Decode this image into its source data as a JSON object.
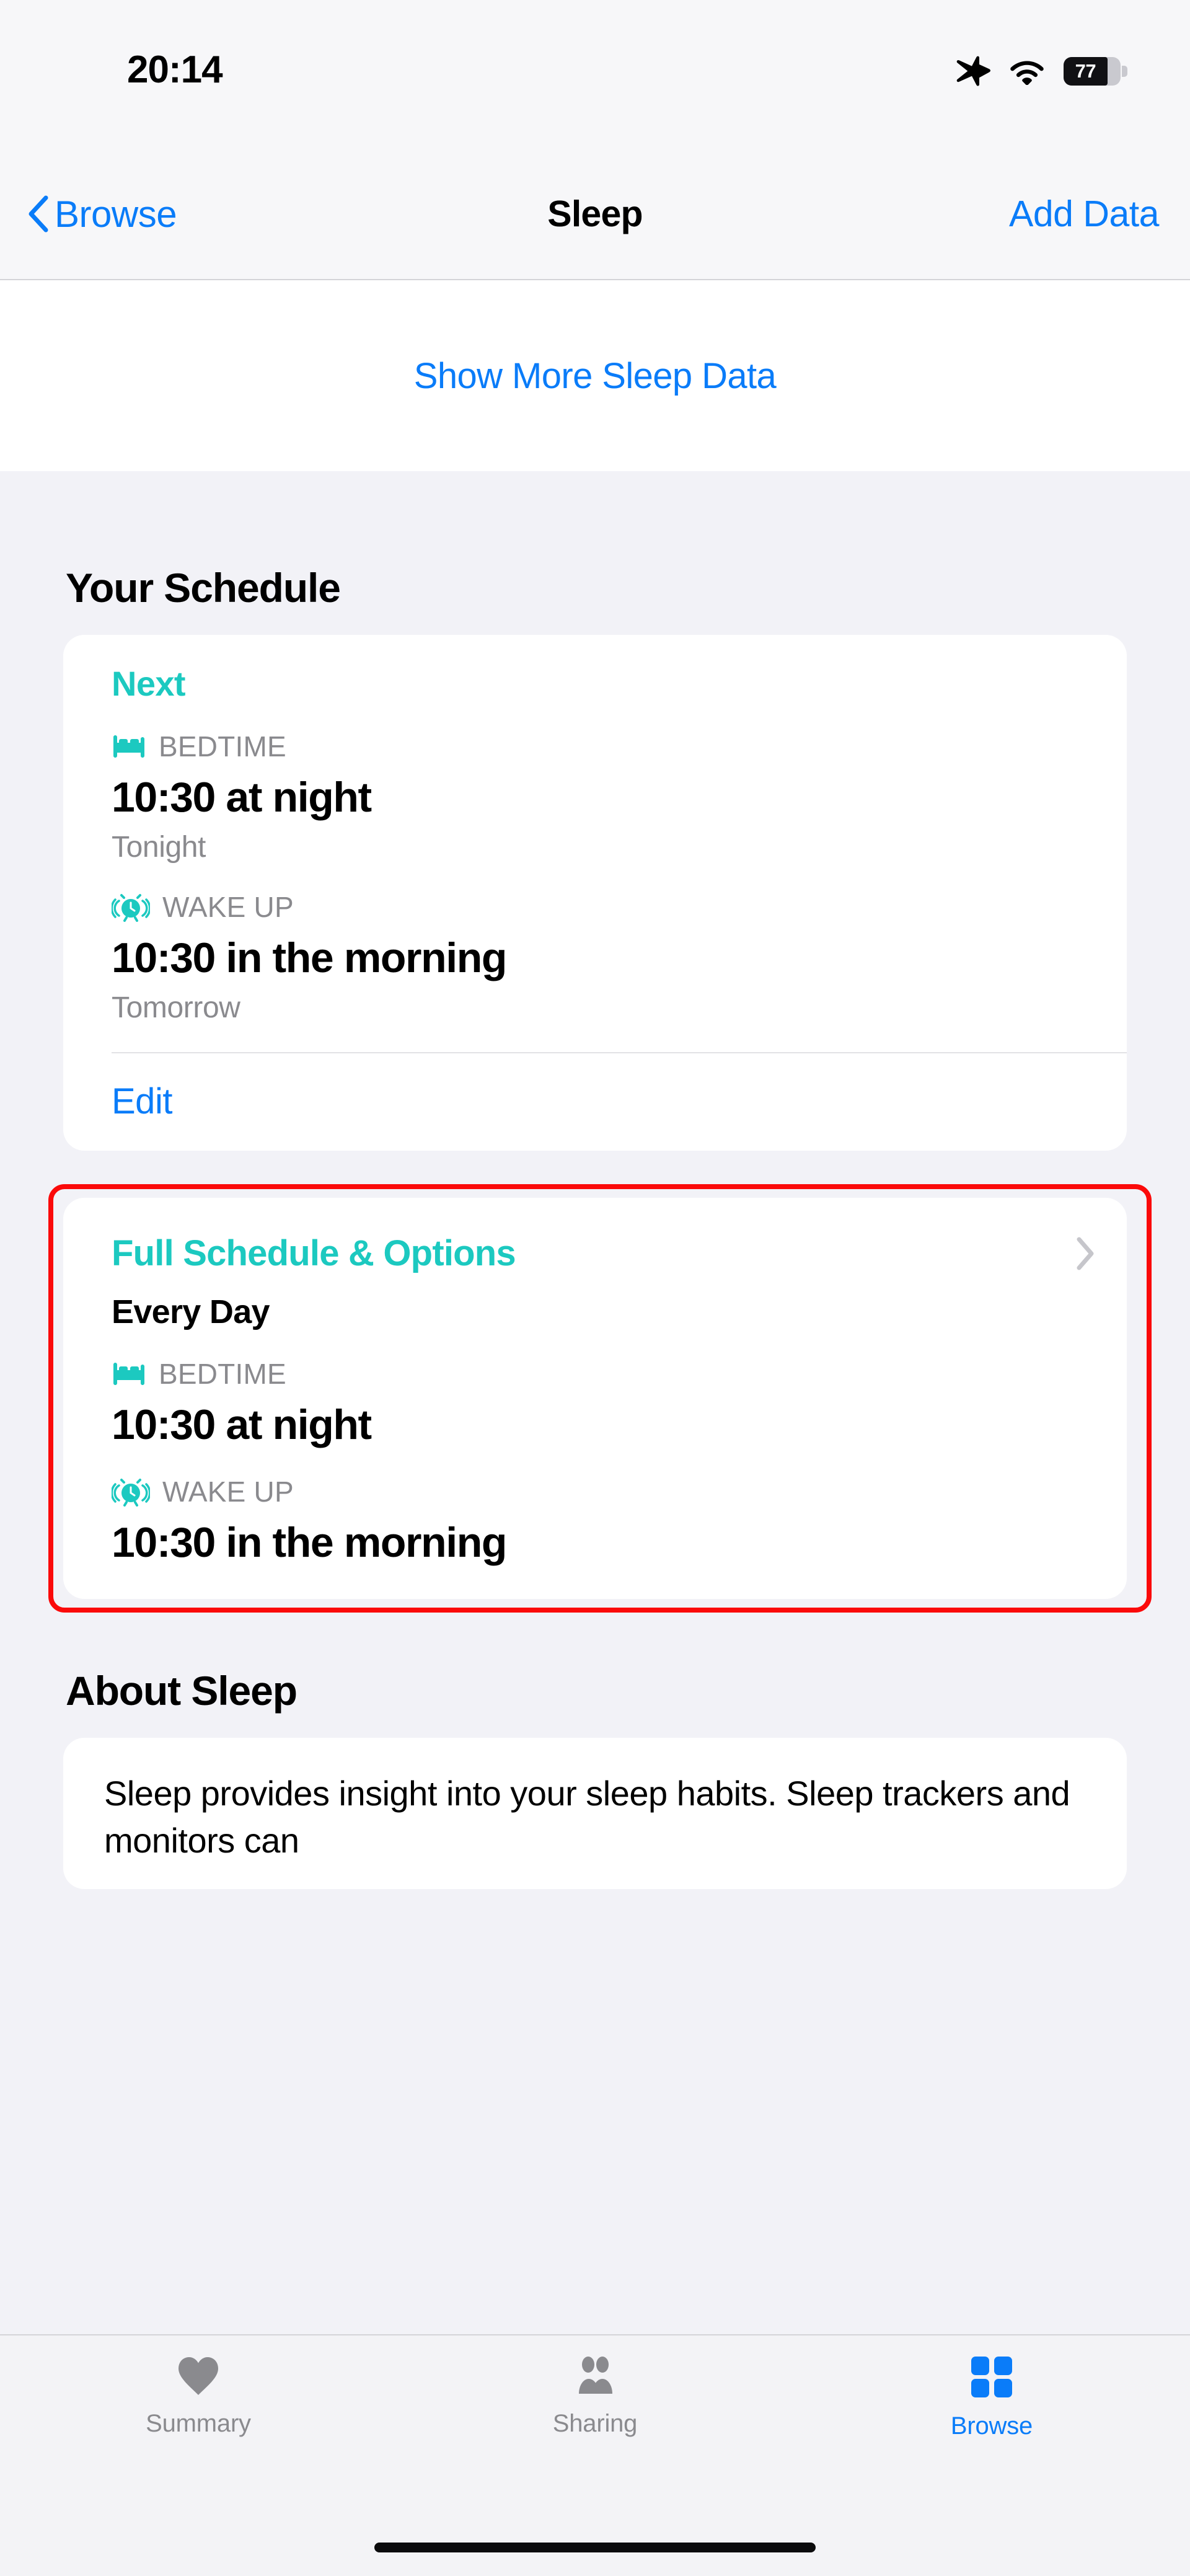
{
  "status_bar": {
    "time": "20:14",
    "battery_percent": "77",
    "icons": [
      "airplane-mode-icon",
      "wifi-icon",
      "battery-icon"
    ]
  },
  "nav_bar": {
    "back_label": "Browse",
    "title": "Sleep",
    "action_label": "Add Data"
  },
  "show_more": {
    "label": "Show More Sleep Data"
  },
  "sections": {
    "schedule_heading": "Your Schedule",
    "about_heading": "About Sleep"
  },
  "next_card": {
    "badge": "Next",
    "bedtime_label": "BEDTIME",
    "bedtime_value": "10:30 at night",
    "bedtime_day": "Tonight",
    "wakeup_label": "WAKE UP",
    "wakeup_value": "10:30 in the morning",
    "wakeup_day": "Tomorrow",
    "edit_label": "Edit"
  },
  "full_schedule_card": {
    "title": "Full Schedule & Options",
    "repeat": "Every Day",
    "bedtime_label": "BEDTIME",
    "bedtime_value": "10:30 at night",
    "wakeup_label": "WAKE UP",
    "wakeup_value": "10:30 in the morning",
    "chevron": "chevron-right-icon",
    "highlighted": true,
    "highlight_color": "#fb0a0a"
  },
  "about_card": {
    "body": "Sleep provides insight into your sleep habits. Sleep trackers and monitors can"
  },
  "tab_bar": {
    "tabs": [
      {
        "label": "Summary",
        "icon": "heart-icon",
        "active": false
      },
      {
        "label": "Sharing",
        "icon": "people-icon",
        "active": false
      },
      {
        "label": "Browse",
        "icon": "grid-icon",
        "active": true
      }
    ]
  },
  "colors": {
    "accent_blue": "#0a7cf9",
    "sleep_teal": "#1cc9c0",
    "highlight_red": "#fb0a0a",
    "secondary_text": "#8a8a8e",
    "group_background": "#f2f2f7"
  }
}
